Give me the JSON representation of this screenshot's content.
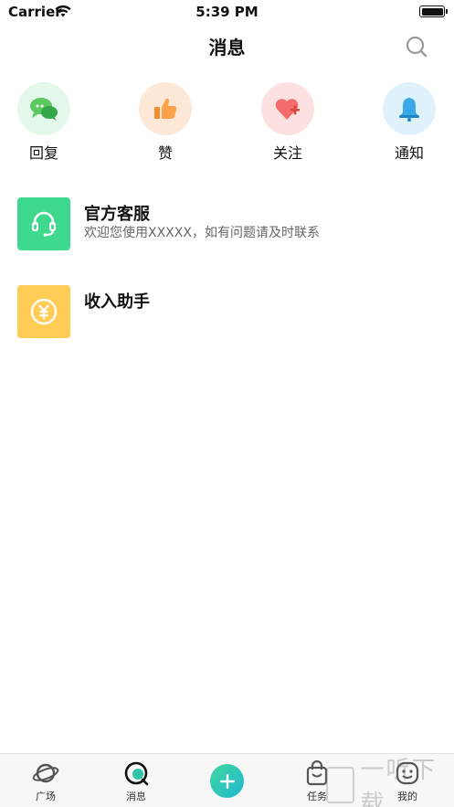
{
  "status_bar": {
    "carrier": "Carrier",
    "time": "5:39 PM"
  },
  "nav": {
    "title": "消息"
  },
  "quick_actions": [
    {
      "label": "回复",
      "icon": "chat-bubbles-icon",
      "bg": "#e3f7ea"
    },
    {
      "label": "赞",
      "icon": "thumbs-up-icon",
      "bg": "#fde8d8"
    },
    {
      "label": "关注",
      "icon": "heart-plus-icon",
      "bg": "#fde1e1"
    },
    {
      "label": "通知",
      "icon": "bell-icon",
      "bg": "#dff1fb"
    }
  ],
  "messages": [
    {
      "title": "官方客服",
      "subtitle": "欢迎您使用XXXXX，如有问题请及时联系",
      "icon": "headset-icon",
      "bg": "#3ed98c"
    },
    {
      "title": "收入助手",
      "subtitle": "",
      "icon": "yen-icon",
      "bg": "#ffcd55"
    }
  ],
  "tab_bar": {
    "items": [
      {
        "label": "广场",
        "icon": "planet-icon"
      },
      {
        "label": "消息",
        "icon": "message-icon"
      },
      {
        "label": "",
        "icon": "plus-icon"
      },
      {
        "label": "任务",
        "icon": "bag-icon"
      },
      {
        "label": "我的",
        "icon": "smile-icon"
      }
    ]
  },
  "watermark": {
    "text": "一听下载"
  },
  "colors": {
    "accent": "#2ec5a6",
    "text_primary": "#111111",
    "text_secondary": "#666666"
  }
}
